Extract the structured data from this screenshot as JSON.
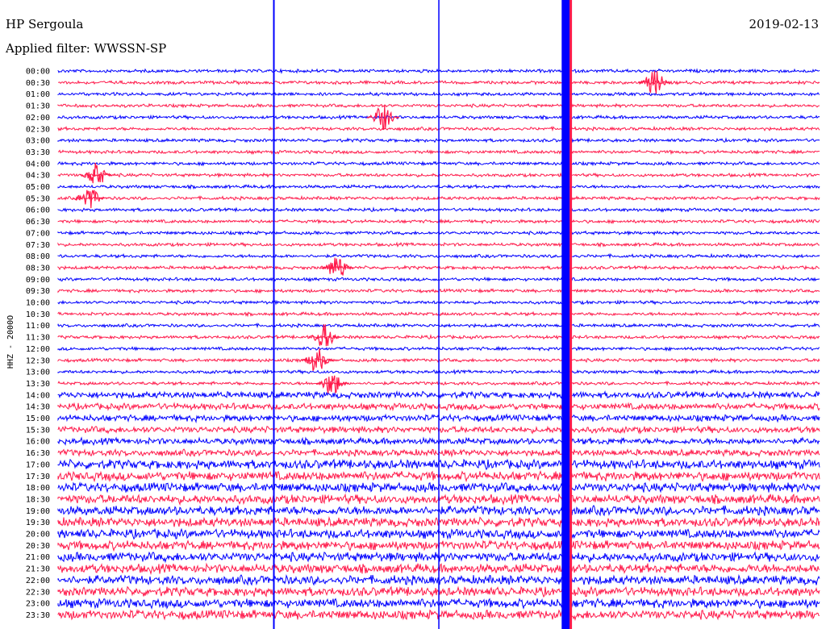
{
  "header": {
    "station": "HP Sergoula",
    "filter": "Applied filter: WWSSN-SP",
    "date": "2019-02-13"
  },
  "chart_data": {
    "type": "line",
    "title": "HP Sergoula",
    "ylabel": "HHZ - 2000O",
    "trace_colors": [
      "#0000ff",
      "#ff1a4b"
    ],
    "rows": [
      "00:00",
      "00:30",
      "01:00",
      "01:30",
      "02:00",
      "02:30",
      "03:00",
      "03:30",
      "04:00",
      "04:30",
      "05:00",
      "05:30",
      "06:00",
      "06:30",
      "07:00",
      "07:30",
      "08:00",
      "08:30",
      "09:00",
      "09:30",
      "10:00",
      "10:30",
      "11:00",
      "11:30",
      "12:00",
      "12:30",
      "13:00",
      "13:30",
      "14:00",
      "14:30",
      "15:00",
      "15:30",
      "16:00",
      "16:30",
      "17:00",
      "17:30",
      "18:00",
      "18:30",
      "19:00",
      "19:30",
      "20:00",
      "20:30",
      "21:00",
      "21:30",
      "22:00",
      "22:30",
      "23:00",
      "23:30"
    ],
    "spike_columns_min": [
      8.5,
      15,
      20,
      20.2
    ],
    "event_markers": [
      {
        "row": "00:30",
        "minute": 23.5,
        "color": "#ff1a4b"
      },
      {
        "row": "02:00",
        "minute": 12.8,
        "color": "#ff1a4b"
      },
      {
        "row": "04:30",
        "minute": 1.5,
        "color": "#ff1a4b"
      },
      {
        "row": "05:30",
        "minute": 1.2,
        "color": "#ff1a4b"
      },
      {
        "row": "08:30",
        "minute": 11,
        "color": "#ff1a4b"
      },
      {
        "row": "11:30",
        "minute": 10.5,
        "color": "#ff1a4b"
      },
      {
        "row": "12:30",
        "minute": 10.2,
        "color": "#ff1a4b"
      },
      {
        "row": "13:30",
        "minute": 10.8,
        "color": "#ff1a4b"
      }
    ]
  }
}
